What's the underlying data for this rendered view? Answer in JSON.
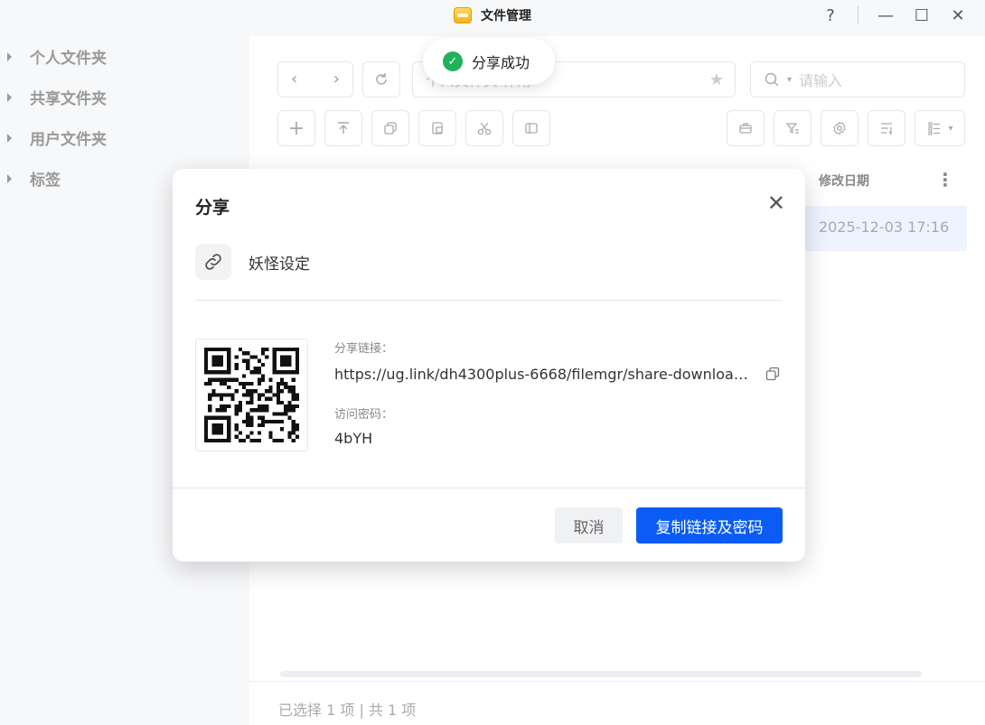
{
  "window": {
    "title": "文件管理",
    "help": "?",
    "minimize": "—",
    "maximize": "☐",
    "close": "✕"
  },
  "sidebar": {
    "items": [
      {
        "label": "个人文件夹"
      },
      {
        "label": "共享文件夹"
      },
      {
        "label": "用户文件夹"
      },
      {
        "label": "标签"
      }
    ]
  },
  "toolbar": {
    "path_text": "个人文件夹  作用",
    "search_placeholder": "请输入"
  },
  "table": {
    "col_modified": "修改日期",
    "rows": [
      {
        "modified": "2025-12-03 17:16"
      }
    ]
  },
  "status_bar": {
    "text": "已选择 1 项 | 共 1 项"
  },
  "toast": {
    "message": "分享成功"
  },
  "share_dialog": {
    "title": "分享",
    "file_name": "妖怪设定",
    "link_label": "分享链接：",
    "link_value": "https://ug.link/dh4300plus-6668/filemgr/share-download/?...",
    "password_label": "访问密码：",
    "password_value": "4bYH",
    "cancel_label": "取消",
    "confirm_label": "复制链接及密码"
  },
  "colors": {
    "primary": "#0a5cf5",
    "success": "#1fb25a",
    "selected_row": "#eef3ff"
  }
}
